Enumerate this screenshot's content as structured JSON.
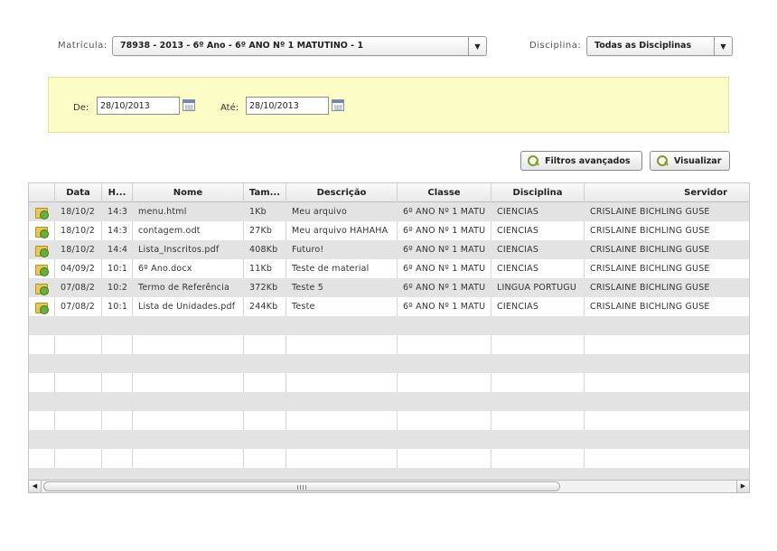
{
  "filters": {
    "matricula_label": "Matrícula:",
    "matricula_value": "78938 - 2013 - 6º Ano - 6º ANO Nº 1 MATUTINO - 1",
    "disciplina_label": "Disciplina:",
    "disciplina_value": "Todas as Disciplinas"
  },
  "dates": {
    "from_label": "De:",
    "from_value": "28/10/2013",
    "to_label": "Até:",
    "to_value": "28/10/2013"
  },
  "buttons": {
    "advanced_filters": "Filtros avançados",
    "view": "Visualizar"
  },
  "table": {
    "columns": [
      "Data",
      "H...",
      "Nome",
      "Tam...",
      "Descrição",
      "Classe",
      "Disciplina",
      "Servidor"
    ],
    "rows": [
      [
        "18/10/2",
        "14:3",
        "menu.html",
        "1Kb",
        "Meu arquivo",
        "6º ANO Nº 1 MATU",
        "CIENCIAS",
        "CRISLAINE BICHLING GUSE"
      ],
      [
        "18/10/2",
        "14:3",
        "contagem.odt",
        "27Kb",
        "Meu arquivo HAHAHA",
        "6º ANO Nº 1 MATU",
        "CIENCIAS",
        "CRISLAINE BICHLING GUSE"
      ],
      [
        "18/10/2",
        "14:4",
        "Lista_Inscritos.pdf",
        "408Kb",
        "Futuro!",
        "6º ANO Nº 1 MATU",
        "CIENCIAS",
        "CRISLAINE BICHLING GUSE"
      ],
      [
        "04/09/2",
        "10:1",
        "6º Ano.docx",
        "11Kb",
        "Teste de material",
        "6º ANO Nº 1 MATU",
        "CIENCIAS",
        "CRISLAINE BICHLING GUSE"
      ],
      [
        "07/08/2",
        "10:2",
        "Termo de Referência",
        "372Kb",
        "Teste 5",
        "6º ANO Nº 1 MATU",
        "LINGUA PORTUGU",
        "CRISLAINE BICHLING GUSE"
      ],
      [
        "07/08/2",
        "10:1",
        "Lista de Unidades.pdf",
        "244Kb",
        "Teste",
        "6º ANO Nº 1 MATU",
        "CIENCIAS",
        "CRISLAINE BICHLING GUSE"
      ]
    ]
  },
  "icons": {
    "row_icon": "download-file-icon",
    "calendar": "calendar-icon",
    "search": "magnifier-icon"
  }
}
